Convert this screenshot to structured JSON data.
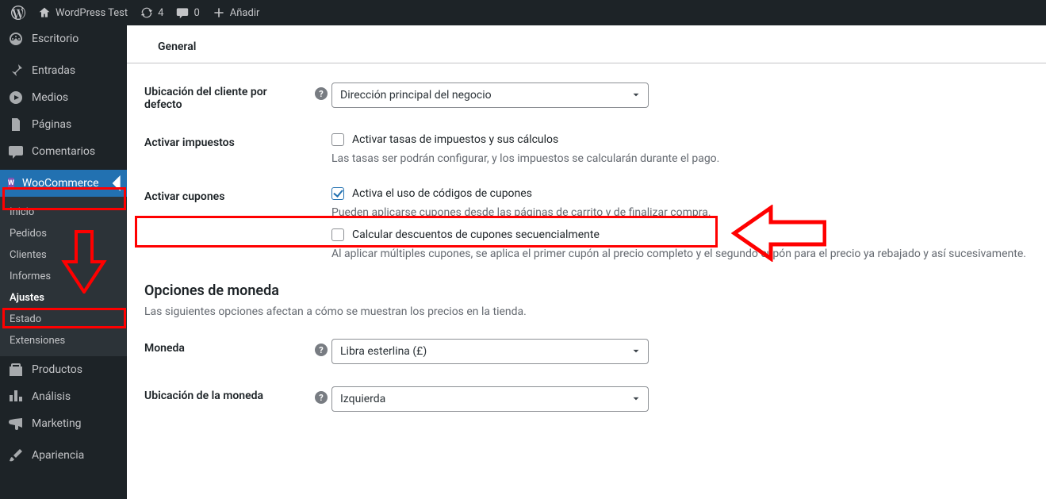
{
  "adminbar": {
    "site_title": "WordPress Test",
    "updates_count": "4",
    "comments_count": "0",
    "add_new": "Añadir"
  },
  "sidebar": {
    "items": [
      {
        "id": "dashboard",
        "label": "Escritorio"
      },
      {
        "id": "posts",
        "label": "Entradas"
      },
      {
        "id": "media",
        "label": "Medios"
      },
      {
        "id": "pages",
        "label": "Páginas"
      },
      {
        "id": "comments",
        "label": "Comentarios"
      },
      {
        "id": "woocommerce",
        "label": "WooCommerce"
      },
      {
        "id": "products",
        "label": "Productos"
      },
      {
        "id": "analytics",
        "label": "Análisis"
      },
      {
        "id": "marketing",
        "label": "Marketing"
      },
      {
        "id": "appearance",
        "label": "Apariencia"
      }
    ],
    "woocommerce_sub": [
      {
        "id": "home",
        "label": "Inicio"
      },
      {
        "id": "orders",
        "label": "Pedidos"
      },
      {
        "id": "customers",
        "label": "Clientes"
      },
      {
        "id": "reports",
        "label": "Informes"
      },
      {
        "id": "settings",
        "label": "Ajustes"
      },
      {
        "id": "status",
        "label": "Estado"
      },
      {
        "id": "extensions",
        "label": "Extensiones"
      }
    ]
  },
  "tabs": {
    "general": "General"
  },
  "form": {
    "default_customer_location": {
      "label": "Ubicación del cliente por defecto",
      "value": "Dirección principal del negocio"
    },
    "enable_taxes": {
      "label": "Activar impuestos",
      "checkbox_label": "Activar tasas de impuestos y sus cálculos",
      "help": "Las tasas ser podrán configurar, y los impuestos se calcularán durante el pago."
    },
    "enable_coupons": {
      "label": "Activar cupones",
      "checkbox1_label": "Activa el uso de códigos de cupones",
      "help1": "Pueden aplicarse cupones desde las páginas de carrito y de finalizar compra.",
      "checkbox2_label": "Calcular descuentos de cupones secuencialmente",
      "help2": "Al aplicar múltiples cupones, se aplica el primer cupón al precio completo y el segundo cupón para el precio ya rebajado y así sucesivamente."
    },
    "currency_section": {
      "title": "Opciones de moneda",
      "desc": "Las siguientes opciones afectan a cómo se muestran los precios en la tienda."
    },
    "currency": {
      "label": "Moneda",
      "value": "Libra esterlina (£)"
    },
    "currency_position": {
      "label": "Ubicación de la moneda",
      "value": "Izquierda"
    }
  }
}
